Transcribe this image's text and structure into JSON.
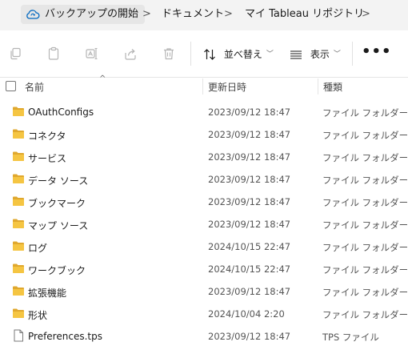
{
  "breadcrumb": {
    "items": [
      {
        "label": "バックアップの開始"
      },
      {
        "label": "ドキュメント"
      },
      {
        "label": "マイ Tableau リポジトリ"
      }
    ],
    "separator": ">"
  },
  "toolbar": {
    "sort_label": "並べ替え",
    "view_label": "表示",
    "more_label": "•••",
    "chevron": "﹀"
  },
  "columns": {
    "name": "名前",
    "date": "更新日時",
    "type": "種類"
  },
  "files": [
    {
      "name": "OAuthConfigs",
      "date": "2023/09/12 18:47",
      "type": "ファイル フォルダー",
      "kind": "folder"
    },
    {
      "name": "コネクタ",
      "date": "2023/09/12 18:47",
      "type": "ファイル フォルダー",
      "kind": "folder"
    },
    {
      "name": "サービス",
      "date": "2023/09/12 18:47",
      "type": "ファイル フォルダー",
      "kind": "folder"
    },
    {
      "name": "データ ソース",
      "date": "2023/09/12 18:47",
      "type": "ファイル フォルダー",
      "kind": "folder"
    },
    {
      "name": "ブックマーク",
      "date": "2023/09/12 18:47",
      "type": "ファイル フォルダー",
      "kind": "folder"
    },
    {
      "name": "マップ ソース",
      "date": "2023/09/12 18:47",
      "type": "ファイル フォルダー",
      "kind": "folder"
    },
    {
      "name": "ログ",
      "date": "2024/10/15 22:47",
      "type": "ファイル フォルダー",
      "kind": "folder"
    },
    {
      "name": "ワークブック",
      "date": "2024/10/15 22:47",
      "type": "ファイル フォルダー",
      "kind": "folder"
    },
    {
      "name": "拡張機能",
      "date": "2023/09/12 18:47",
      "type": "ファイル フォルダー",
      "kind": "folder"
    },
    {
      "name": "形状",
      "date": "2024/10/04 2:20",
      "type": "ファイル フォルダー",
      "kind": "folder"
    },
    {
      "name": "Preferences.tps",
      "date": "2023/09/12 18:47",
      "type": "TPS ファイル",
      "kind": "file"
    }
  ],
  "colors": {
    "folder": "#f5c542",
    "folder_dark": "#e0a82e",
    "accent": "#0067c0"
  },
  "icons": {
    "home": "cloud-sync-icon",
    "copy": "copy-icon",
    "paste": "paste-icon",
    "rename": "rename-icon",
    "share": "share-icon",
    "delete": "delete-icon",
    "sort": "sort-icon",
    "view": "view-icon",
    "folder": "folder-icon",
    "file": "file-icon"
  }
}
